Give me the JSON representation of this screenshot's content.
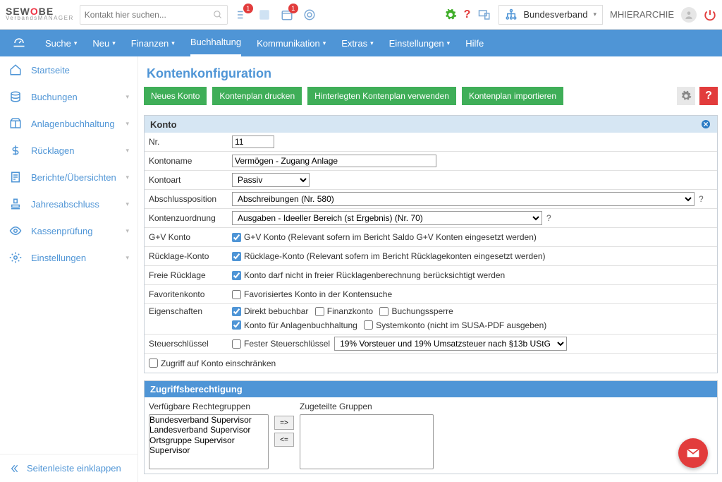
{
  "top": {
    "search_placeholder": "Kontakt hier suchen...",
    "badge1": "1",
    "badge2": "1",
    "org": "Bundesverband",
    "user": "MHIERARCHIE"
  },
  "mainnav": {
    "items": [
      "Suche",
      "Neu",
      "Finanzen",
      "Buchhaltung",
      "Kommunikation",
      "Extras",
      "Einstellungen",
      "Hilfe"
    ],
    "active": "Buchhaltung"
  },
  "sidebar": {
    "items": [
      {
        "icon": "home",
        "label": "Startseite",
        "expand": false
      },
      {
        "icon": "coins",
        "label": "Buchungen",
        "expand": true
      },
      {
        "icon": "box",
        "label": "Anlagenbuchhaltung",
        "expand": true
      },
      {
        "icon": "dollar",
        "label": "Rücklagen",
        "expand": true
      },
      {
        "icon": "report",
        "label": "Berichte/Übersichten",
        "expand": true
      },
      {
        "icon": "stamp",
        "label": "Jahresabschluss",
        "expand": true
      },
      {
        "icon": "eye",
        "label": "Kassenprüfung",
        "expand": true
      },
      {
        "icon": "gear",
        "label": "Einstellungen",
        "expand": true
      }
    ],
    "collapse_label": "Seitenleiste einklappen"
  },
  "page": {
    "title": "Kontenkonfiguration",
    "buttons": [
      "Neues Konto",
      "Kontenplan drucken",
      "Hinterlegten Kontenplan verwenden",
      "Kontenplan importieren"
    ]
  },
  "account": {
    "heading": "Konto",
    "labels": {
      "nr": "Nr.",
      "name": "Kontoname",
      "art": "Kontoart",
      "abschluss": "Abschlussposition",
      "zuordnung": "Kontenzuordnung",
      "gv": "G+V Konto",
      "rueck": "Rücklage-Konto",
      "frei": "Freie Rücklage",
      "fav": "Favoritenkonto",
      "eig": "Eigenschaften",
      "tax": "Steuerschlüssel",
      "restrict": "Zugriff auf Konto einschränken"
    },
    "nr": "11",
    "name": "Vermögen - Zugang Anlage",
    "art": "Passiv",
    "abschluss": "Abschreibungen (Nr. 580)",
    "zuordnung": "Ausgaben - Ideeller Bereich (st Ergebnis) (Nr. 70)",
    "gv_hint": "G+V Konto (Relevant sofern im Bericht Saldo G+V Konten eingesetzt werden)",
    "rueck_hint": "Rücklage-Konto (Relevant sofern im Bericht Rücklagekonten eingesetzt werden)",
    "frei_hint": "Konto darf nicht in freier Rücklagenberechnung berücksichtigt werden",
    "fav_hint": "Favorisiertes Konto in der Kontensuche",
    "eig_items": {
      "a": "Direkt bebuchbar",
      "b": "Finanzkonto",
      "c": "Buchungssperre",
      "d": "Konto für Anlagenbuchhaltung",
      "e": "Systemkonto (nicht im SUSA-PDF ausgeben)"
    },
    "tax_fixed": "Fester Steuerschlüssel",
    "tax_sel": "19% Vorsteuer und 19% Umsatzsteuer nach §13b UStG"
  },
  "perm": {
    "heading": "Zugriffsberechtigung",
    "avail_label": "Verfügbare Rechtegruppen",
    "assign_label": "Zugeteilte Gruppen",
    "avail": [
      "Bundesverband Supervisor",
      "Landesverband Supervisor",
      "Ortsgruppe Supervisor",
      "Supervisor"
    ]
  }
}
